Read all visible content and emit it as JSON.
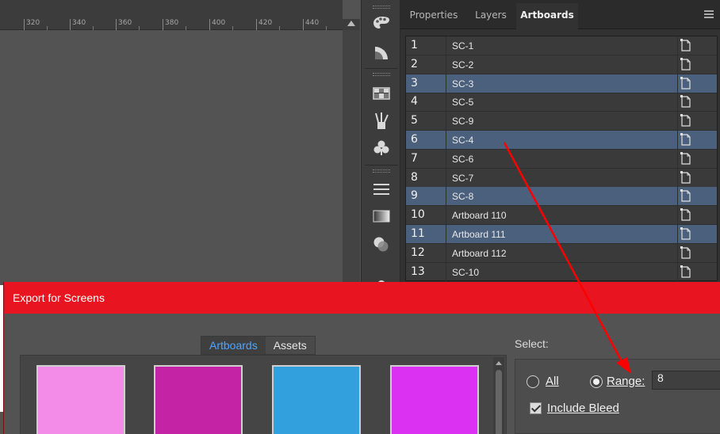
{
  "ruler": {
    "labels": [
      "320",
      "340",
      "360",
      "380",
      "400",
      "420",
      "440"
    ]
  },
  "toolstrip": {
    "tools": [
      "palette-icon",
      "color-guide-icon",
      "swatch-grid-icon",
      "brushes-icon",
      "symbols-icon",
      "stroke-icon",
      "gradient-icon",
      "transparency-icon",
      "appearance-icon"
    ]
  },
  "panel": {
    "tabs": [
      "Properties",
      "Layers",
      "Artboards"
    ],
    "active_tab": "Artboards",
    "artboards": [
      {
        "num": "1",
        "name": "SC-1",
        "selected": false
      },
      {
        "num": "2",
        "name": "SC-2",
        "selected": false
      },
      {
        "num": "3",
        "name": "SC-3",
        "selected": true
      },
      {
        "num": "4",
        "name": "SC-5",
        "selected": false
      },
      {
        "num": "5",
        "name": "SC-9",
        "selected": false
      },
      {
        "num": "6",
        "name": "SC-4",
        "selected": true
      },
      {
        "num": "7",
        "name": "SC-6",
        "selected": false
      },
      {
        "num": "8",
        "name": "SC-7",
        "selected": false
      },
      {
        "num": "9",
        "name": "SC-8",
        "selected": true
      },
      {
        "num": "10",
        "name": "Artboard 110",
        "selected": false
      },
      {
        "num": "11",
        "name": "Artboard 111",
        "selected": true
      },
      {
        "num": "12",
        "name": "Artboard 112",
        "selected": false
      },
      {
        "num": "13",
        "name": "SC-10",
        "selected": false
      }
    ]
  },
  "dialog": {
    "title": "Export for Screens",
    "tabs": {
      "artboards": "Artboards",
      "assets": "Assets"
    },
    "thumb_colors": [
      "#f38ce8",
      "#c423a6",
      "#31a0dc",
      "#da31f2"
    ],
    "select_label": "Select:",
    "all_label": "All",
    "range_label": "Range:",
    "range_value": "8",
    "include_bleed_label": "Include Bleed"
  },
  "colors": {
    "titlebar": "#e8141f",
    "selected_row": "#4b607c",
    "annotation_arrow": "#ff0000",
    "active_tab_text": "#4ea5ff"
  }
}
